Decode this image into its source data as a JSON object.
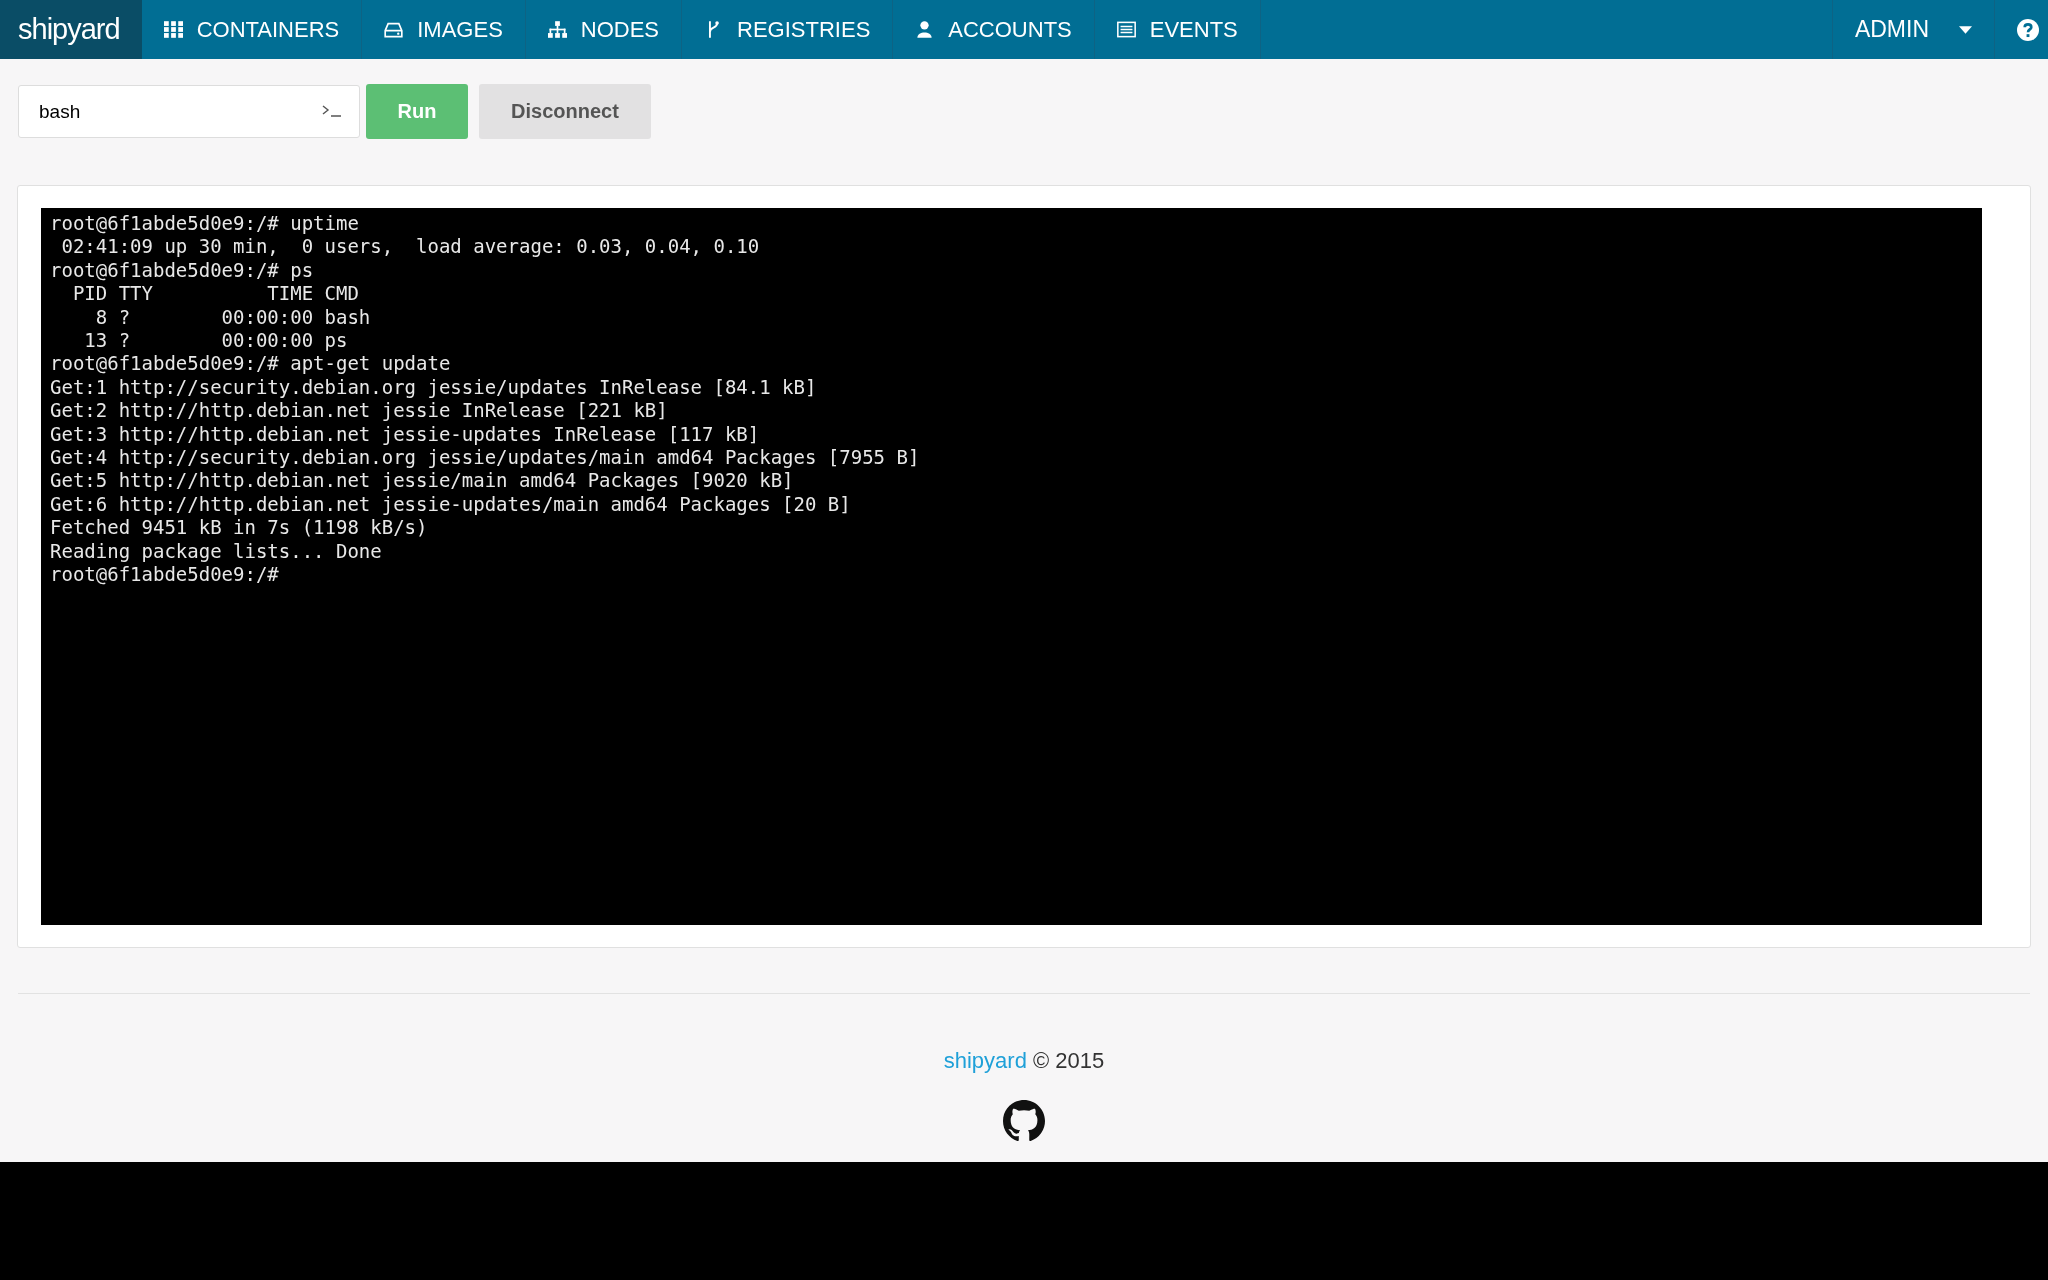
{
  "navbar": {
    "brand": "shipyard",
    "items": [
      {
        "label": "CONTAINERS",
        "kind": "grid",
        "selected": false
      },
      {
        "label": "IMAGES",
        "kind": "drive",
        "selected": false
      },
      {
        "label": "NODES",
        "kind": "tree",
        "selected": false
      },
      {
        "label": "REGISTRIES",
        "kind": "fork",
        "selected": false
      },
      {
        "label": "ACCOUNTS",
        "kind": "user",
        "selected": false
      },
      {
        "label": "EVENTS",
        "kind": "list",
        "selected": false
      }
    ],
    "user_menu": "ADMIN"
  },
  "command_bar": {
    "value": "bash",
    "buttons": [
      {
        "label": "Run",
        "kind": "primary"
      },
      {
        "label": "Disconnect",
        "kind": "default"
      }
    ]
  },
  "terminal": {
    "lines": [
      "root@6f1abde5d0e9:/# uptime",
      " 02:41:09 up 30 min,  0 users,  load average: 0.03, 0.04, 0.10",
      "root@6f1abde5d0e9:/# ps",
      "  PID TTY          TIME CMD",
      "    8 ?        00:00:00 bash",
      "   13 ?        00:00:00 ps",
      "root@6f1abde5d0e9:/# apt-get update",
      "Get:1 http://security.debian.org jessie/updates InRelease [84.1 kB]",
      "Get:2 http://http.debian.net jessie InRelease [221 kB]",
      "Get:3 http://http.debian.net jessie-updates InRelease [117 kB]",
      "Get:4 http://security.debian.org jessie/updates/main amd64 Packages [7955 B]",
      "Get:5 http://http.debian.net jessie/main amd64 Packages [9020 kB]",
      "Get:6 http://http.debian.net jessie-updates/main amd64 Packages [20 B]",
      "Fetched 9451 kB in 7s (1198 kB/s)",
      "Reading package lists... Done",
      "root@6f1abde5d0e9:/#"
    ]
  },
  "footer": {
    "link": "shipyard",
    "copyright": "© 2015"
  }
}
